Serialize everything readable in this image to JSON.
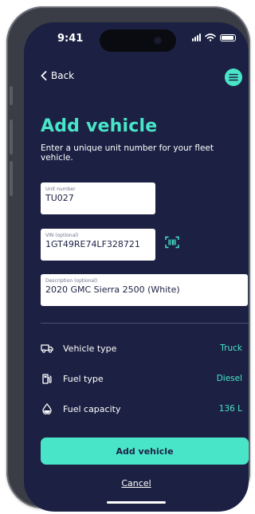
{
  "status_bar": {
    "time": "9:41"
  },
  "nav": {
    "back_label": "Back"
  },
  "header": {
    "title": "Add vehicle",
    "subtitle": "Enter a unique unit number for your fleet vehicle."
  },
  "form": {
    "unit": {
      "label": "Unit number",
      "value": "TU027"
    },
    "vin": {
      "label": "VIN (optional)",
      "value": "1GT49RE74LF328721"
    },
    "description": {
      "label": "Description (optional)",
      "value": "2020 GMC Sierra 2500 (White)"
    }
  },
  "details": [
    {
      "icon": "truck-icon",
      "label": "Vehicle type",
      "value": "Truck"
    },
    {
      "icon": "fuel-pump-icon",
      "label": "Fuel type",
      "value": "Diesel"
    },
    {
      "icon": "droplet-icon",
      "label": "Fuel capacity",
      "value": "136 L"
    }
  ],
  "actions": {
    "primary_label": "Add vehicle",
    "cancel_label": "Cancel"
  },
  "colors": {
    "background": "#1c2143",
    "accent": "#49e5c9",
    "text": "#ffffff"
  }
}
